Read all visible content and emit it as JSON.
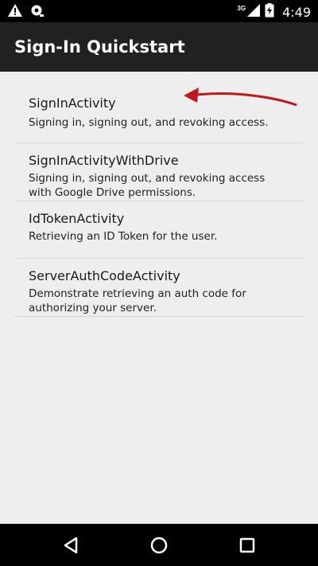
{
  "status_bar": {
    "network_type": "3G",
    "time": "4:49",
    "icons": [
      "warning-icon",
      "sync-icon",
      "signal-icon",
      "battery-charging-icon"
    ]
  },
  "app_bar": {
    "title": "Sign-In Quickstart"
  },
  "list": {
    "items": [
      {
        "title": "SignInActivity",
        "subtitle": "Signing in, signing out, and revoking access."
      },
      {
        "title": "SignInActivityWithDrive",
        "subtitle": "Signing in, signing out, and revoking access with Google Drive permissions."
      },
      {
        "title": "IdTokenActivity",
        "subtitle": "Retrieving an ID Token for the user."
      },
      {
        "title": "ServerAuthCodeActivity",
        "subtitle": "Demonstrate retrieving an auth code for authorizing your server."
      }
    ]
  },
  "annotation": {
    "arrow_color": "#c0161c"
  },
  "nav_bar": {
    "icons": [
      "back-icon",
      "home-icon",
      "recents-icon"
    ]
  }
}
